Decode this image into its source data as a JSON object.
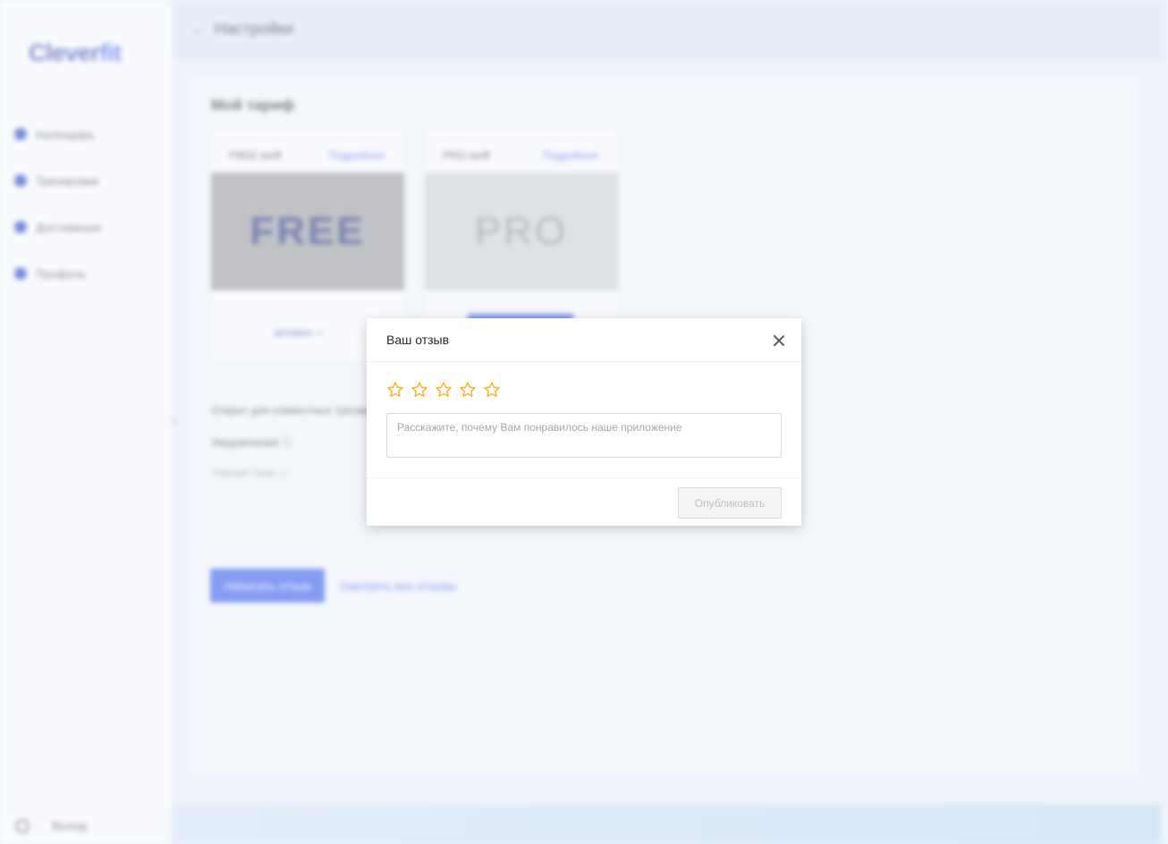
{
  "app": {
    "logo_clever": "Clever",
    "logo_fit": "fit",
    "sidebar": {
      "items": [
        {
          "label": "Календарь"
        },
        {
          "label": "Тренировки"
        },
        {
          "label": "Достижения"
        },
        {
          "label": "Профиль"
        }
      ],
      "exit_label": "Выход"
    },
    "header": {
      "back_icon": "arrow-left-icon",
      "title": "Настройки"
    },
    "tariffs": {
      "section_title": "Мой тариф",
      "cards": [
        {
          "name": "FREE tariff",
          "more": "Подробнее",
          "image_text": "FREE",
          "status": "активен ✓"
        },
        {
          "name": "PRO tariff",
          "more": "Подробнее",
          "image_text": "PRO"
        }
      ]
    },
    "options": [
      {
        "label": "Открыт для совместных тренировок"
      },
      {
        "label": "Уведомления ⓘ"
      },
      {
        "label": "Тёмная тема ⓘ"
      }
    ],
    "actions": {
      "write_feedback": "Написать отзыв",
      "view_feedbacks": "Смотреть все отзывы"
    }
  },
  "modal": {
    "title": "Ваш отзыв",
    "rating": {
      "value": 0,
      "max": 5,
      "star_color": "#faad14"
    },
    "textarea_placeholder": "Расскажите, почему Вам понравилось наше приложение",
    "textarea_value": "",
    "publish_label": "Опубликовать",
    "publish_disabled": true
  },
  "colors": {
    "primary": "#2f54eb",
    "star": "#faad14",
    "disabled_text": "#bfbfbf"
  }
}
